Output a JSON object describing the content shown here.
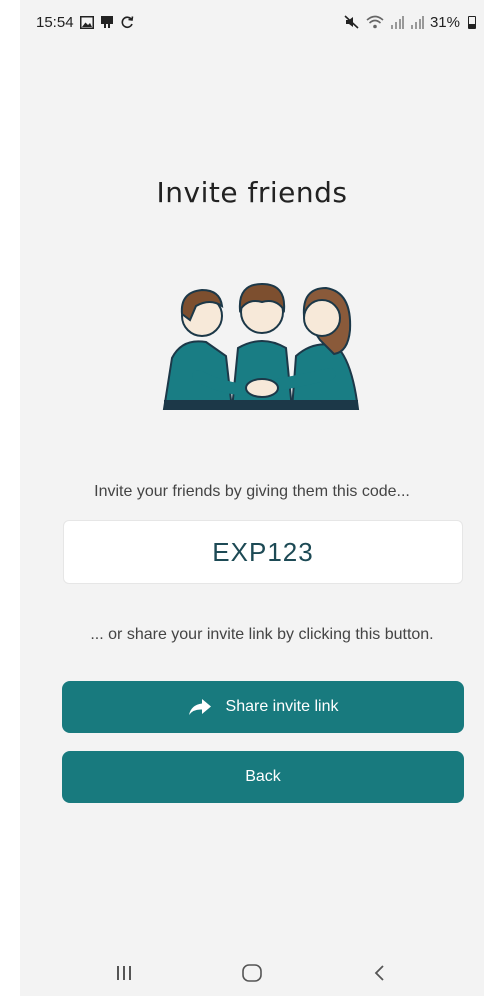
{
  "status_bar": {
    "time": "15:54",
    "battery": "31%",
    "icons_left": [
      "gallery-icon",
      "cast-icon",
      "sync-icon"
    ],
    "icons_right": [
      "mute-icon",
      "wifi-icon",
      "signal-icon",
      "signal-icon",
      "battery-icon"
    ]
  },
  "page": {
    "title": "Invite friends",
    "prompt": "Invite your friends by giving them this code...",
    "code": "EXP123",
    "share_text": "... or share your invite link by clicking this button."
  },
  "buttons": {
    "share_label": "Share invite link",
    "back_label": "Back"
  },
  "colors": {
    "accent": "#187a7e",
    "background": "#f3f3f3",
    "code_text": "#1d4a55"
  },
  "nav": [
    "recent-apps-icon",
    "home-icon",
    "back-icon"
  ]
}
